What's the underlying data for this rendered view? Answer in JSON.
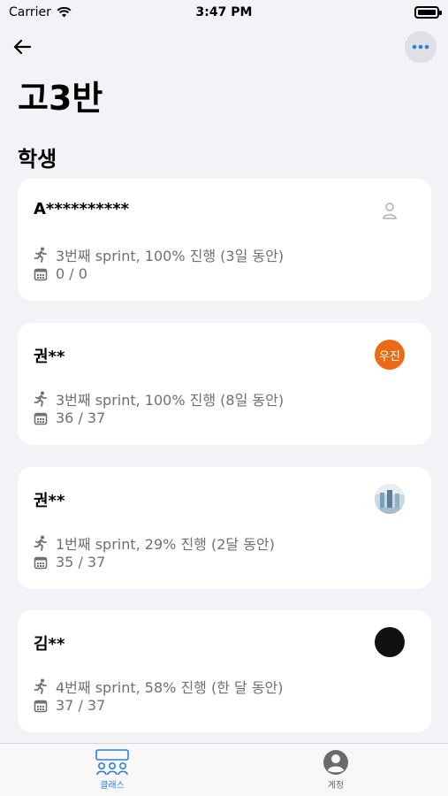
{
  "status_bar": {
    "carrier": "Carrier",
    "time": "3:47 PM"
  },
  "header": {
    "title": "고3반",
    "back_icon": "arrow-left-icon",
    "more_icon": "ellipsis-icon"
  },
  "section": {
    "title": "학생"
  },
  "students": [
    {
      "name": "A**********",
      "sprint": "3번째 sprint, 100% 진행 (3일 동안)",
      "count": "0 / 0",
      "avatar": {
        "type": "placeholder",
        "icon": "person-outline-icon"
      }
    },
    {
      "name": "권**",
      "sprint": "3번째 sprint, 100% 진행 (8일 동안)",
      "count": "36 / 37",
      "avatar": {
        "type": "text",
        "text": "우진",
        "color": "#ec6a16"
      }
    },
    {
      "name": "권**",
      "sprint": "1번째 sprint, 29% 진행 (2달 동안)",
      "count": "35 / 37",
      "avatar": {
        "type": "photo",
        "icon": "photo-avatar-icon"
      }
    },
    {
      "name": "김**",
      "sprint": "4번째 sprint, 58% 진행 (한 달 동안)",
      "count": "37 / 37",
      "avatar": {
        "type": "solid",
        "color": "#111111"
      }
    }
  ],
  "tabs": [
    {
      "label": "클래스",
      "icon": "class-group-icon",
      "active": true
    },
    {
      "label": "계정",
      "icon": "account-circle-icon",
      "active": false
    }
  ],
  "colors": {
    "accent": "#2f7fe0",
    "background": "#f2f2f7",
    "secondary_text": "#6f6f74"
  }
}
